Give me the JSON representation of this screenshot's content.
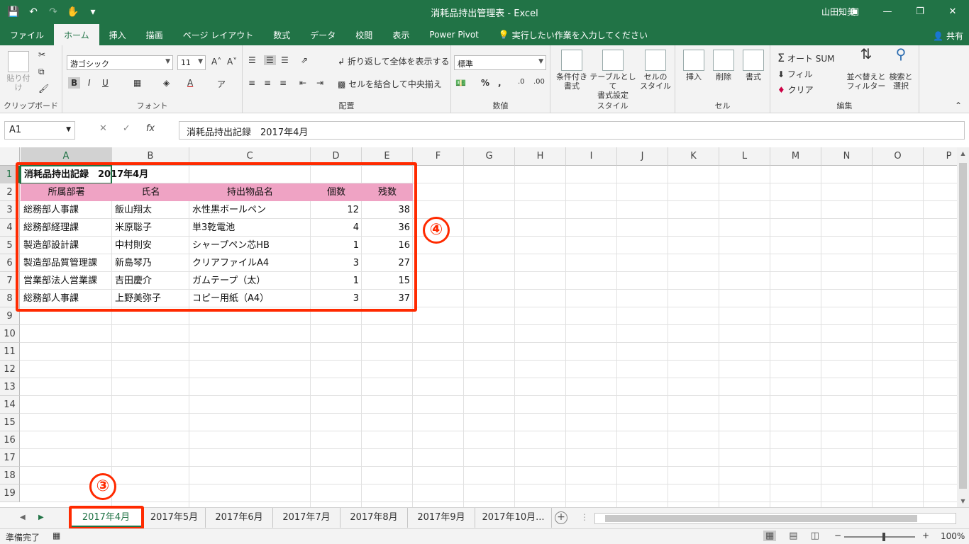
{
  "window": {
    "title": "消耗品持出管理表  -  Excel",
    "user": "山田知美",
    "share": "共有"
  },
  "ribbon_tabs": [
    "ファイル",
    "ホーム",
    "挿入",
    "描画",
    "ページ レイアウト",
    "数式",
    "データ",
    "校閲",
    "表示",
    "Power Pivot"
  ],
  "tell_me": "実行したい作業を入力してください",
  "ribbon": {
    "clipboard": {
      "label": "クリップボード",
      "paste": "貼り付け"
    },
    "font": {
      "label": "フォント",
      "name": "游ゴシック",
      "size": "11"
    },
    "alignment": {
      "label": "配置",
      "wrap": "折り返して全体を表示する",
      "merge": "セルを結合して中央揃え"
    },
    "number": {
      "label": "数値",
      "format": "標準"
    },
    "styles": {
      "label": "スタイル",
      "conditional": "条件付き\n書式",
      "table": "テーブルとして\n書式設定",
      "cell": "セルの\nスタイル"
    },
    "cells": {
      "label": "セル",
      "insert": "挿入",
      "delete": "削除",
      "format": "書式"
    },
    "editing": {
      "label": "編集",
      "autosum": "オート SUM",
      "fill": "フィル",
      "clear": "クリア",
      "sort": "並べ替えと\nフィルター",
      "find": "検索と\n選択"
    }
  },
  "formula_bar": {
    "name_box": "A1",
    "fx": "fx",
    "content": "消耗品持出記録　2017年4月"
  },
  "columns": [
    "A",
    "B",
    "C",
    "D",
    "E",
    "F",
    "G",
    "H",
    "I",
    "J",
    "K",
    "L",
    "M",
    "N",
    "O",
    "P"
  ],
  "rows": [
    "1",
    "2",
    "3",
    "4",
    "5",
    "6",
    "7",
    "8",
    "9",
    "10",
    "11",
    "12",
    "13",
    "14",
    "15",
    "16",
    "17",
    "18",
    "19"
  ],
  "sheet": {
    "title": "消耗品持出記録　2017年4月",
    "headers": [
      "所属部署",
      "氏名",
      "持出物品名",
      "個数",
      "残数"
    ],
    "records": [
      [
        "総務部人事課",
        "飯山翔太",
        "水性黒ボールペン",
        "12",
        "38"
      ],
      [
        "総務部経理課",
        "米原聡子",
        "単3乾電池",
        "4",
        "36"
      ],
      [
        "製造部設計課",
        "中村則安",
        "シャープペン芯HB",
        "1",
        "16"
      ],
      [
        "製造部品質管理課",
        "新島琴乃",
        "クリアファイルA4",
        "3",
        "27"
      ],
      [
        "営業部法人営業課",
        "吉田慶介",
        "ガムテープ（太）",
        "1",
        "15"
      ],
      [
        "総務部人事課",
        "上野美弥子",
        "コピー用紙（A4）",
        "3",
        "37"
      ]
    ]
  },
  "annotations": {
    "range_marker": "④",
    "tab_marker": "③"
  },
  "sheet_tabs": [
    "2017年4月",
    "2017年5月",
    "2017年6月",
    "2017年7月",
    "2017年8月",
    "2017年9月",
    "2017年10月..."
  ],
  "status": {
    "ready": "準備完了",
    "zoom": "100%"
  },
  "colors": {
    "excel_green": "#217346",
    "header_fill": "#efa3c4",
    "annotation_red": "#ff2a00"
  }
}
